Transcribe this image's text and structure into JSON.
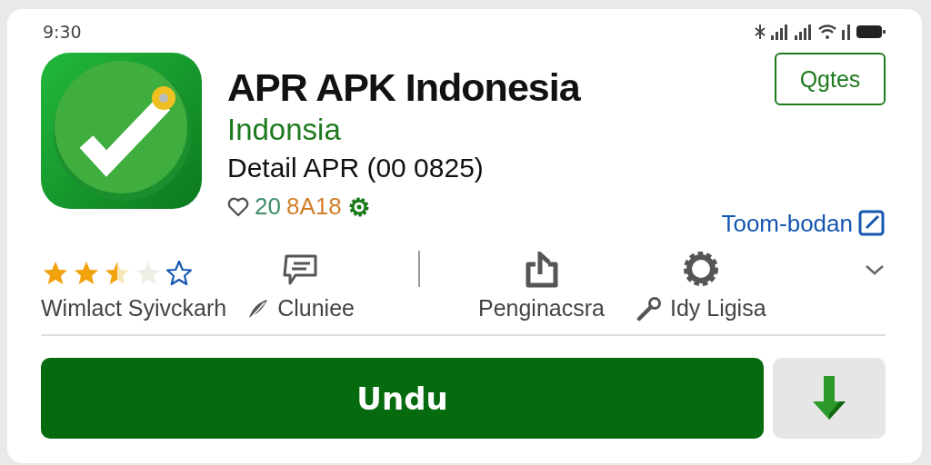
{
  "status_bar": {
    "time": "9:30"
  },
  "app": {
    "title": "APR APK Indonesia",
    "developer": "Indonsia",
    "detail": "Detail APR (00 0825)",
    "likes": "20",
    "code": "8A18",
    "open_button": "Qgtes",
    "link": "Toom-bodan"
  },
  "actions": [
    {
      "kind": "rating",
      "stars": 2.5,
      "label": "Wimlact Syivckarh"
    },
    {
      "kind": "comment",
      "label": "Cluniee"
    },
    {
      "kind": "share",
      "label": "Penginacsra"
    },
    {
      "kind": "settings",
      "label": "Idy Ligisa"
    }
  ],
  "install_button": "Undu"
}
